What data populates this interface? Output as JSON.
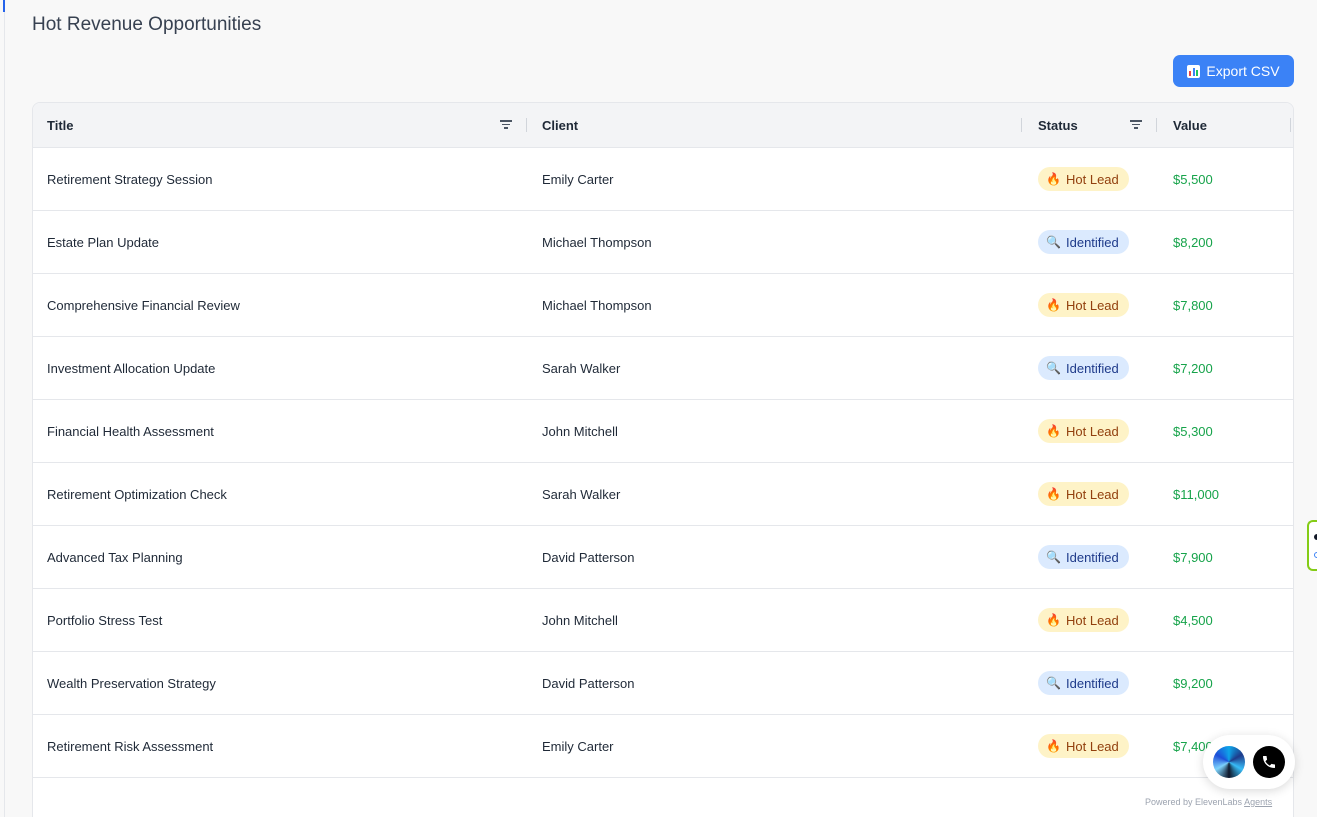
{
  "page": {
    "title": "Hot Revenue Opportunities"
  },
  "toolbar": {
    "export_label": "Export CSV",
    "export_icon": "bar-chart-icon"
  },
  "columns": {
    "title": "Title",
    "client": "Client",
    "status": "Status",
    "value": "Value"
  },
  "rows": [
    {
      "title": "Retirement Strategy Session",
      "client": "Emily Carter",
      "status": "Hot Lead",
      "value": "$5,500"
    },
    {
      "title": "Estate Plan Update",
      "client": "Michael Thompson",
      "status": "Identified",
      "value": "$8,200"
    },
    {
      "title": "Comprehensive Financial Review",
      "client": "Michael Thompson",
      "status": "Hot Lead",
      "value": "$7,800"
    },
    {
      "title": "Investment Allocation Update",
      "client": "Sarah Walker",
      "status": "Identified",
      "value": "$7,200"
    },
    {
      "title": "Financial Health Assessment",
      "client": "John Mitchell",
      "status": "Hot Lead",
      "value": "$5,300"
    },
    {
      "title": "Retirement Optimization Check",
      "client": "Sarah Walker",
      "status": "Hot Lead",
      "value": "$11,000"
    },
    {
      "title": "Advanced Tax Planning",
      "client": "David Patterson",
      "status": "Identified",
      "value": "$7,900"
    },
    {
      "title": "Portfolio Stress Test",
      "client": "John Mitchell",
      "status": "Hot Lead",
      "value": "$4,500"
    },
    {
      "title": "Wealth Preservation Strategy",
      "client": "David Patterson",
      "status": "Identified",
      "value": "$9,200"
    },
    {
      "title": "Retirement Risk Assessment",
      "client": "Emily Carter",
      "status": "Hot Lead",
      "value": "$7,400"
    }
  ],
  "status_icons": {
    "Hot Lead": "🔥",
    "Identified": "🔍"
  },
  "colors": {
    "accent": "#3b82f6",
    "value_green": "#16a34a",
    "hot_bg": "#fef3c7",
    "hot_text": "#92400e",
    "identified_bg": "#dbeafe",
    "identified_text": "#1e3a8a"
  },
  "footer": {
    "powered_by": "Powered by ElevenLabs",
    "agents_link": "Agents"
  }
}
